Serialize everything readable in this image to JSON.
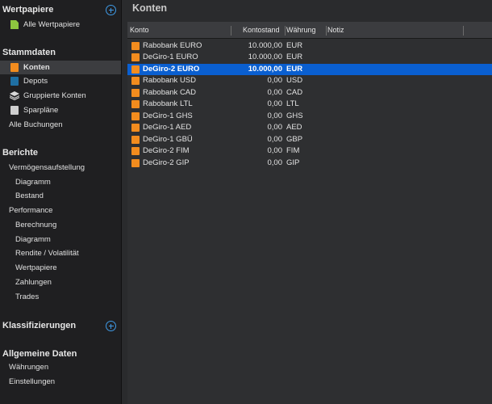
{
  "sidebar": {
    "wertpapiere": {
      "title": "Wertpapiere",
      "items": [
        {
          "label": "Alle Wertpapiere",
          "icon": "document-icon"
        }
      ]
    },
    "stammdaten": {
      "title": "Stammdaten",
      "items": [
        {
          "label": "Konten",
          "icon": "account-icon",
          "selected": true
        },
        {
          "label": "Depots",
          "icon": "portfolio-icon"
        },
        {
          "label": "Gruppierte Konten",
          "icon": "layers-icon"
        },
        {
          "label": "Sparpläne",
          "icon": "calendar-icon"
        },
        {
          "label": "Alle Buchungen"
        }
      ]
    },
    "berichte": {
      "title": "Berichte",
      "items": [
        {
          "label": "Vermögensaufstellung"
        },
        {
          "label": "Diagramm"
        },
        {
          "label": "Bestand"
        },
        {
          "label": "Performance"
        },
        {
          "label": "Berechnung"
        },
        {
          "label": "Diagramm"
        },
        {
          "label": "Rendite / Volatilität"
        },
        {
          "label": "Wertpapiere"
        },
        {
          "label": "Zahlungen"
        },
        {
          "label": "Trades"
        }
      ]
    },
    "klassifizierungen": {
      "title": "Klassifizierungen"
    },
    "allgemeine": {
      "title": "Allgemeine Daten",
      "items": [
        {
          "label": "Währungen"
        },
        {
          "label": "Einstellungen"
        }
      ]
    }
  },
  "main": {
    "title": "Konten",
    "columns": {
      "konto": "Konto",
      "kontostand": "Kontostand",
      "waehrung": "Währung",
      "notiz": "Notiz"
    },
    "rows": [
      {
        "name": "Rabobank EURO",
        "balance": "10.000,00",
        "currency": "EUR"
      },
      {
        "name": "DeGiro-1 EURO",
        "balance": "10.000,00",
        "currency": "EUR"
      },
      {
        "name": "DeGiro-2 EURO",
        "balance": "10.000,00",
        "currency": "EUR",
        "selected": true
      },
      {
        "name": "Rabobank USD",
        "balance": "0,00",
        "currency": "USD"
      },
      {
        "name": "Rabobank CAD",
        "balance": "0,00",
        "currency": "CAD"
      },
      {
        "name": "Rabobank LTL",
        "balance": "0,00",
        "currency": "LTL"
      },
      {
        "name": "DeGiro-1 GHS",
        "balance": "0,00",
        "currency": "GHS"
      },
      {
        "name": "DeGiro-1 AED",
        "balance": "0,00",
        "currency": "AED"
      },
      {
        "name": "DeGiro-1 GBÜ",
        "balance": "0,00",
        "currency": "GBP"
      },
      {
        "name": "DeGiro-2 FIM",
        "balance": "0,00",
        "currency": "FIM"
      },
      {
        "name": "DeGiro-2 GIP",
        "balance": "0,00",
        "currency": "GIP"
      }
    ]
  },
  "colors": {
    "accent": "#3f9ae6",
    "selection": "#0a5fd0",
    "account_icon": "#f28c1e"
  }
}
